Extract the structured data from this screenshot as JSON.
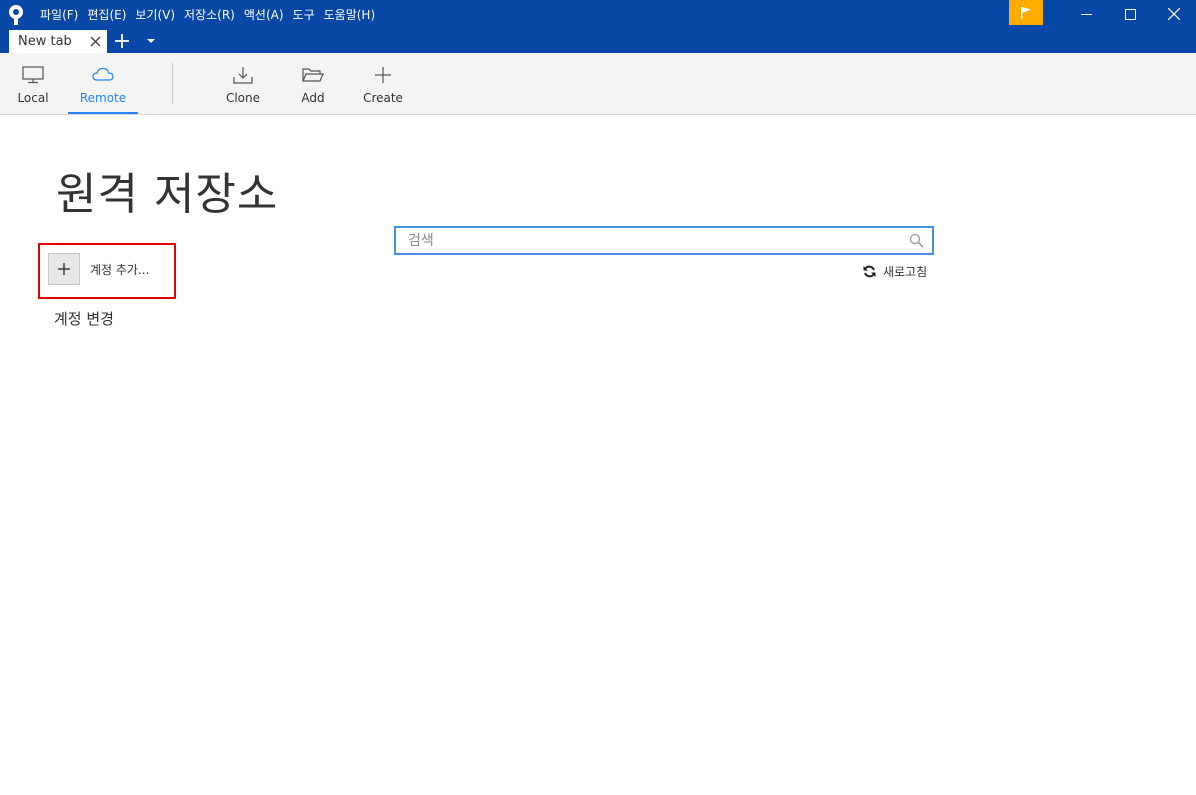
{
  "menu": {
    "items": [
      {
        "label": "파일(F)"
      },
      {
        "label": "편집(E)"
      },
      {
        "label": "보기(V)"
      },
      {
        "label": "저장소(R)"
      },
      {
        "label": "액션(A)"
      },
      {
        "label": "도구"
      },
      {
        "label": "도움말(H)"
      }
    ]
  },
  "tabs": [
    {
      "label": "New tab"
    }
  ],
  "toolbar": {
    "local": "Local",
    "remote": "Remote",
    "clone": "Clone",
    "add": "Add",
    "create": "Create"
  },
  "content": {
    "title": "원격 저장소",
    "add_account_label": "계정 추가...",
    "change_account_label": "계정 변경",
    "search_placeholder": "검색",
    "refresh_label": "새로고침"
  },
  "icons": {
    "app_logo": "sourcetree-logo-icon",
    "flag": "flag-icon",
    "minimize": "minimize-icon",
    "maximize": "maximize-icon",
    "close": "close-icon",
    "tab_close": "close-icon",
    "tab_add": "plus-icon",
    "tab_more": "chevron-down-icon",
    "local": "monitor-icon",
    "remote": "cloud-icon",
    "clone": "download-icon",
    "add": "folder-open-icon",
    "create": "plus-icon",
    "search": "search-icon",
    "refresh": "refresh-icon",
    "add_account": "plus-icon"
  },
  "colors": {
    "titlebar": "#0747a6",
    "accent": "#2684ff",
    "flag": "#ffab00",
    "highlight": "#e00000"
  },
  "toolbar_state": {
    "active": "remote"
  }
}
